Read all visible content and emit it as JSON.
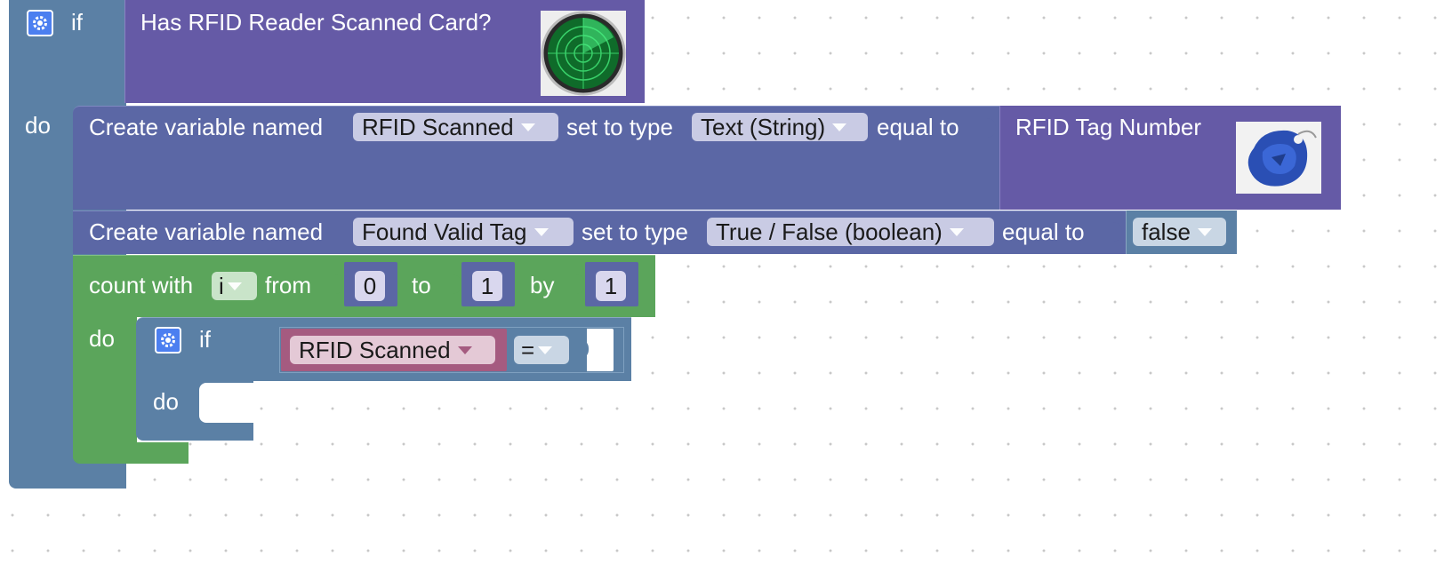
{
  "workspace": {
    "if_outer": {
      "if_label": "if",
      "do_label": "do"
    },
    "condition": {
      "label": "Has RFID Reader Scanned Card?",
      "image_icon": "radar-icon"
    },
    "create_var_1": {
      "prefix": "Create variable named",
      "name_value": "RFID Scanned",
      "type_label": "set to type",
      "type_value": "Text (String)",
      "equal_label": "equal to"
    },
    "rfid_tag": {
      "label": "RFID Tag Number",
      "image_icon": "rfid-keyfob-icon"
    },
    "create_var_2": {
      "prefix": "Create variable named",
      "name_value": "Found Valid Tag",
      "type_label": "set to type",
      "type_value": "True / False (boolean)",
      "equal_label": "equal to",
      "bool_value": "false"
    },
    "count": {
      "label": "count with",
      "var_value": "i",
      "from_label": "from",
      "from_value": "0",
      "to_label": "to",
      "to_value": "1",
      "by_label": "by",
      "by_value": "1",
      "do_label": "do"
    },
    "if_inner": {
      "if_label": "if",
      "do_label": "do",
      "compare_var": "RFID Scanned",
      "operator": "="
    }
  },
  "colors": {
    "control_blue": "#5b80a5",
    "procedure_purple": "#655aa6",
    "variable_purple": "#5b67a5",
    "loop_green": "#5ba55b",
    "text_pink": "#a55b80"
  }
}
